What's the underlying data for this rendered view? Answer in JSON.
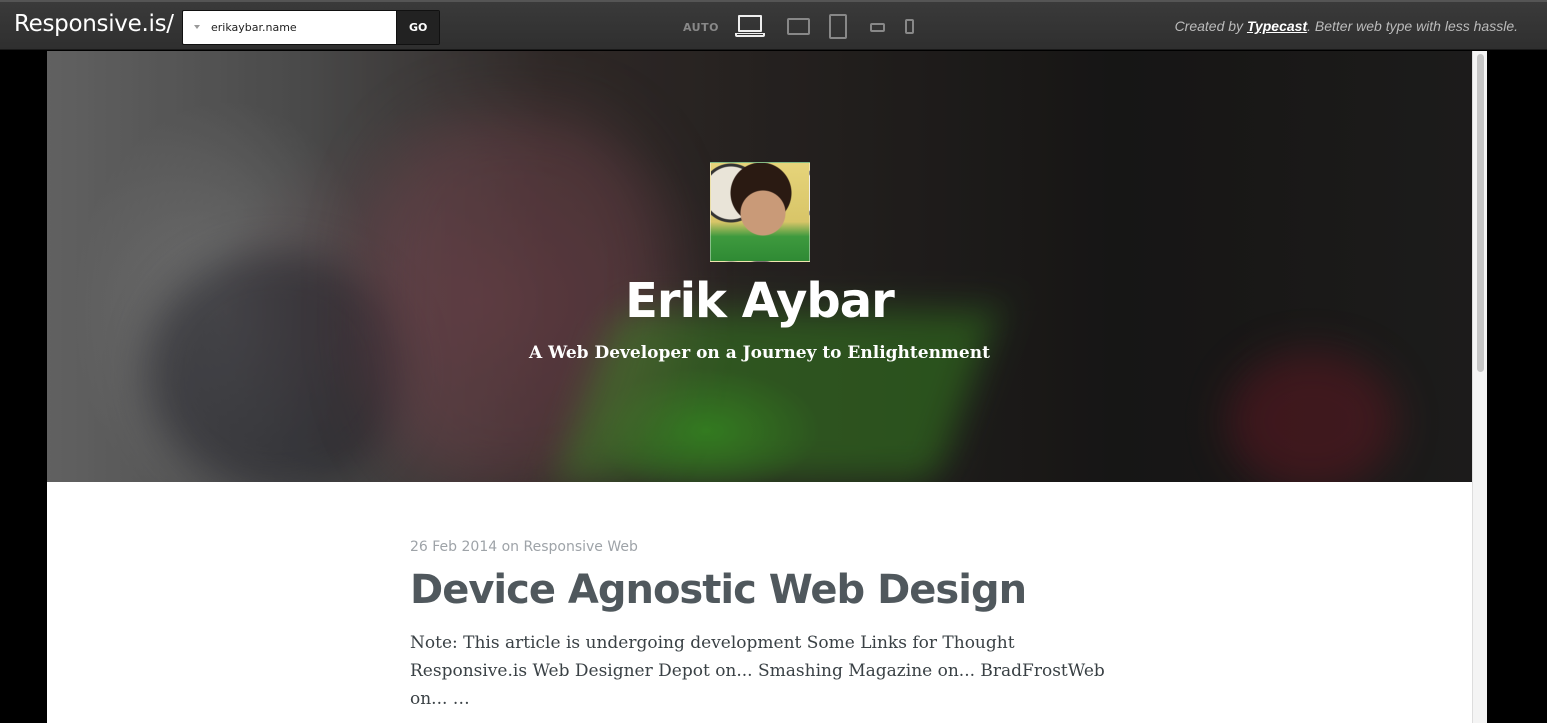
{
  "toolbar": {
    "logo": "Responsive.is/",
    "url_value": "erikaybar.name",
    "go_label": "GO",
    "auto_label": "AUTO",
    "devices": [
      "laptop-icon",
      "tablet-landscape-icon",
      "tablet-portrait-icon",
      "phone-landscape-icon",
      "phone-portrait-icon"
    ],
    "credit_prefix": "Created by ",
    "credit_link": "Typecast",
    "credit_suffix": ". Better web type with less hassle."
  },
  "hero": {
    "title": "Erik Aybar",
    "tagline": "A Web Developer on a Journey to Enlightenment"
  },
  "post": {
    "date": "26 Feb 2014",
    "on": " on ",
    "category": "Responsive Web",
    "title": "Device Agnostic Web Design",
    "excerpt": "Note: This article is undergoing development Some Links for Thought Responsive.is Web Designer Depot on... Smashing Magazine on... BradFrostWeb on... …"
  }
}
